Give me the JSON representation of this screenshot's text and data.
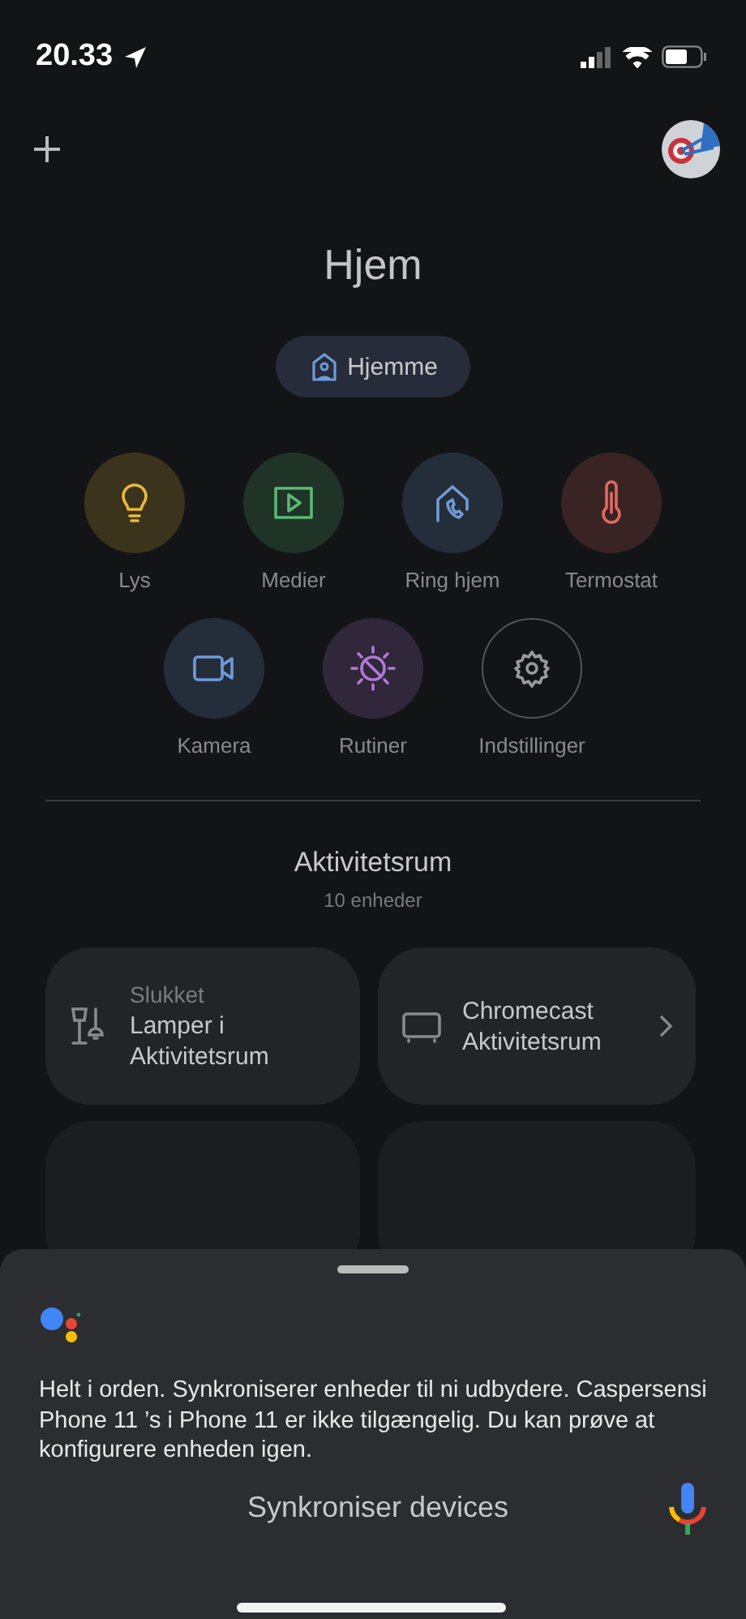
{
  "status_bar": {
    "time": "20.33"
  },
  "header": {
    "title": "Hjem",
    "home_chip": "Hjemme"
  },
  "actions": [
    {
      "label": "Lys",
      "kind": "light",
      "color": "#e8b93b",
      "outlined": false
    },
    {
      "label": "Medier",
      "kind": "media",
      "color": "#5bb874",
      "outlined": false
    },
    {
      "label": "Ring hjem",
      "kind": "call",
      "color": "#6f9bd8",
      "outlined": false
    },
    {
      "label": "Termostat",
      "kind": "thermostat",
      "color": "#e06a60",
      "outlined": false
    },
    {
      "label": "Kamera",
      "kind": "camera",
      "color": "#6f9bd8",
      "outlined": false
    },
    {
      "label": "Rutiner",
      "kind": "routine",
      "color": "#b07ad8",
      "outlined": false
    },
    {
      "label": "Indstillinger",
      "kind": "settings",
      "color": "#9a9a9a",
      "outlined": true
    }
  ],
  "room": {
    "title": "Aktivitetsrum",
    "count": "10 enheder",
    "devices": [
      {
        "kind": "lamp",
        "status": "Slukket",
        "name": "Lamper i Aktivitetsrum",
        "chevron": false
      },
      {
        "kind": "tv",
        "name": "Chromecast Aktivitetsrum",
        "chevron": true
      }
    ]
  },
  "assistant": {
    "response": "Helt i orden. Synkroniserer enheder til ni udbydere. Caspersensi Phone 11 ’s i Phone 11 er ikke tilgængelig. Du kan prøve at konfigurere enheden igen.",
    "query": "Synkroniser devices"
  }
}
